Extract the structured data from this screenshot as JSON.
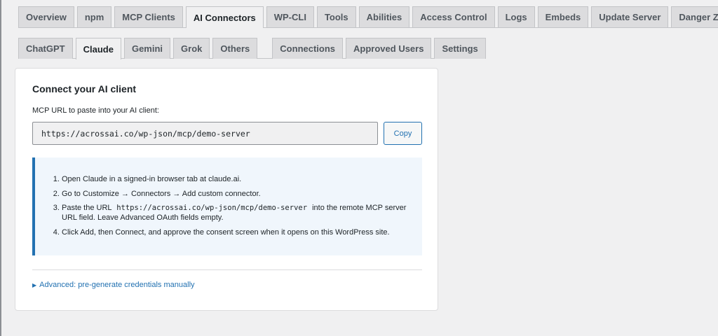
{
  "main_tabs": [
    {
      "label": "Overview",
      "active": false
    },
    {
      "label": "npm",
      "active": false
    },
    {
      "label": "MCP Clients",
      "active": false
    },
    {
      "label": "AI Connectors",
      "active": true
    },
    {
      "label": "WP-CLI",
      "active": false
    },
    {
      "label": "Tools",
      "active": false
    },
    {
      "label": "Abilities",
      "active": false
    },
    {
      "label": "Access Control",
      "active": false
    },
    {
      "label": "Logs",
      "active": false
    },
    {
      "label": "Embeds",
      "active": false
    },
    {
      "label": "Update Server",
      "active": false
    },
    {
      "label": "Danger Zone",
      "active": false
    }
  ],
  "sub_tabs": [
    {
      "label": "ChatGPT",
      "active": false
    },
    {
      "label": "Claude",
      "active": true
    },
    {
      "label": "Gemini",
      "active": false
    },
    {
      "label": "Grok",
      "active": false
    },
    {
      "label": "Others",
      "active": false
    }
  ],
  "sub_tabs_secondary": [
    {
      "label": "Connections",
      "active": false
    },
    {
      "label": "Approved Users",
      "active": false
    },
    {
      "label": "Settings",
      "active": false
    }
  ],
  "card": {
    "title": "Connect your AI client",
    "url_label": "MCP URL to paste into your AI client:",
    "url_value": "https://acrossai.co/wp-json/mcp/demo-server",
    "copy_label": "Copy",
    "steps": [
      {
        "text": "Open Claude in a signed-in browser tab at claude.ai."
      },
      {
        "text": "Go to Customize → Connectors → Add custom connector."
      },
      {
        "pre": "Paste the URL",
        "code": "https://acrossai.co/wp-json/mcp/demo-server",
        "post": "into the remote MCP server URL field. Leave Advanced OAuth fields empty."
      },
      {
        "text": "Click Add, then Connect, and approve the consent screen when it opens on this WordPress site."
      }
    ],
    "advanced_label": "Advanced: pre-generate credentials manually",
    "advanced_icon": "triangle-right-icon"
  },
  "colors": {
    "accent": "#2271b1",
    "page_bg": "#f0f0f1",
    "tab_bg": "#dcdcde",
    "notice_bg": "#f0f6fc"
  }
}
